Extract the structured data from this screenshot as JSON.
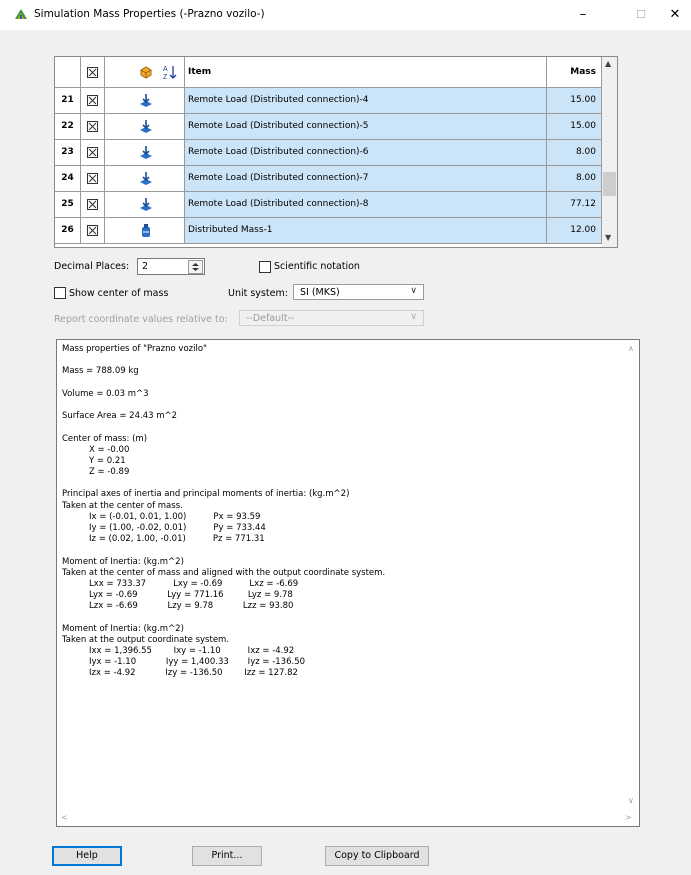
{
  "window": {
    "title": "Simulation Mass Properties (-Prazno vozilo-)",
    "minimize_glyph": "–",
    "maximize_glyph": "☐",
    "close_glyph": "✕"
  },
  "table": {
    "headers": {
      "item": "Item",
      "mass": "Mass (kg)"
    },
    "rows": [
      {
        "num": "21",
        "item": "Remote Load (Distributed connection)-4",
        "mass": "15.00",
        "icon": "remote-load-icon"
      },
      {
        "num": "22",
        "item": "Remote Load (Distributed connection)-5",
        "mass": "15.00",
        "icon": "remote-load-icon"
      },
      {
        "num": "23",
        "item": "Remote Load (Distributed connection)-6",
        "mass": "8.00",
        "icon": "remote-load-icon"
      },
      {
        "num": "24",
        "item": "Remote Load (Distributed connection)-7",
        "mass": "8.00",
        "icon": "remote-load-icon"
      },
      {
        "num": "25",
        "item": "Remote Load (Distributed connection)-8",
        "mass": "77.12",
        "icon": "remote-load-icon"
      },
      {
        "num": "26",
        "item": "Distributed Mass-1",
        "mass": "12.00",
        "icon": "distributed-mass-icon"
      }
    ]
  },
  "controls": {
    "decimal_label": "Decimal Places:",
    "decimal_value": "2",
    "scientific_label": "Scientific notation",
    "show_center_label": "Show center of mass",
    "unit_label": "Unit system:",
    "unit_value": "SI (MKS)",
    "report_label": "Report coordinate values relative to:",
    "report_value": "--Default--"
  },
  "results": {
    "lines": [
      "Mass properties of \"Prazno vozilo\"",
      "",
      "Mass = 788.09 kg",
      "",
      "Volume = 0.03 m^3",
      "",
      "Surface Area = 24.43 m^2",
      "",
      "Center of mass: (m)",
      "          X = -0.00",
      "          Y = 0.21",
      "          Z = -0.89",
      "",
      "Principal axes of inertia and principal moments of inertia: (kg.m^2)",
      "Taken at the center of mass.",
      "          Ix = (-0.01, 0.01, 1.00)          Px = 93.59",
      "          Iy = (1.00, -0.02, 0.01)          Py = 733.44",
      "          Iz = (0.02, 1.00, -0.01)          Pz = 771.31",
      "",
      "Moment of Inertia: (kg.m^2)",
      "Taken at the center of mass and aligned with the output coordinate system.",
      "          Lxx = 733.37          Lxy = -0.69          Lxz = -6.69",
      "          Lyx = -0.69           Lyy = 771.16         Lyz = 9.78",
      "          Lzx = -6.69           Lzy = 9.78           Lzz = 93.80",
      "",
      "Moment of Inertia: (kg.m^2)",
      "Taken at the output coordinate system.",
      "          Ixx = 1,396.55        Ixy = -1.10          Ixz = -4.92",
      "          Iyx = -1.10           Iyy = 1,400.33       Iyz = -136.50",
      "          Izx = -4.92           Izy = -136.50        Izz = 127.82"
    ]
  },
  "buttons": {
    "help": "Help",
    "print": "Print...",
    "copy": "Copy to Clipboard"
  }
}
